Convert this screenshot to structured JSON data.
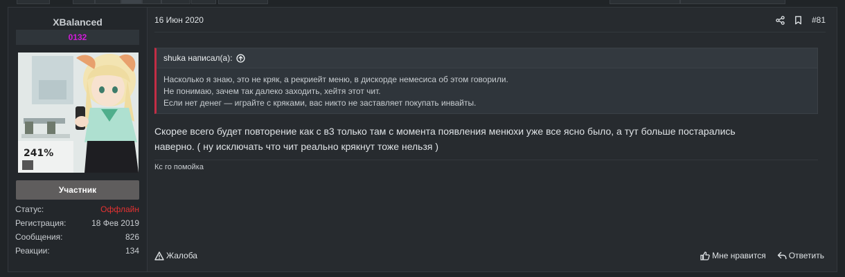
{
  "user": {
    "name": "XBalanced",
    "tag": "0132",
    "role": "Участник",
    "avatar_text": "241%",
    "stats": [
      {
        "label": "Статус:",
        "value": "Оффлайн"
      },
      {
        "label": "Регистрация:",
        "value": "18 Фев 2019"
      },
      {
        "label": "Сообщения:",
        "value": "826"
      },
      {
        "label": "Реакции:",
        "value": "134"
      }
    ]
  },
  "post": {
    "date": "16 Июн 2020",
    "number": "#81",
    "quote": {
      "author": "shuka написал(а):",
      "lines": [
        "Насколько я знаю, это не кряк, а рекриейт меню, в дискорде немесиса об этом говорили.",
        "Не понимаю, зачем так далеко заходить, хейтя этот чит.",
        "Если нет денег — играйте с кряками, вас никто не заставляет покупать инвайты."
      ]
    },
    "message_lines": [
      "Скорее всего будет повторение как с в3 только там с момента появления менюхи уже все ясно было, а тут больше постарались",
      "наверно. ( ну исключать что чит реально крякнут тоже нельзя )"
    ],
    "signature": "Кс го помойка"
  },
  "actions": {
    "report": "Жалоба",
    "like": "Мне нравится",
    "reply": "Ответить"
  },
  "colors": {
    "background": "#202427",
    "panel": "#272b2f",
    "offline": "#e53232",
    "tag": "#d11cd9",
    "quote_accent": "#c32d45",
    "role_bg": "#5f5d5d"
  }
}
